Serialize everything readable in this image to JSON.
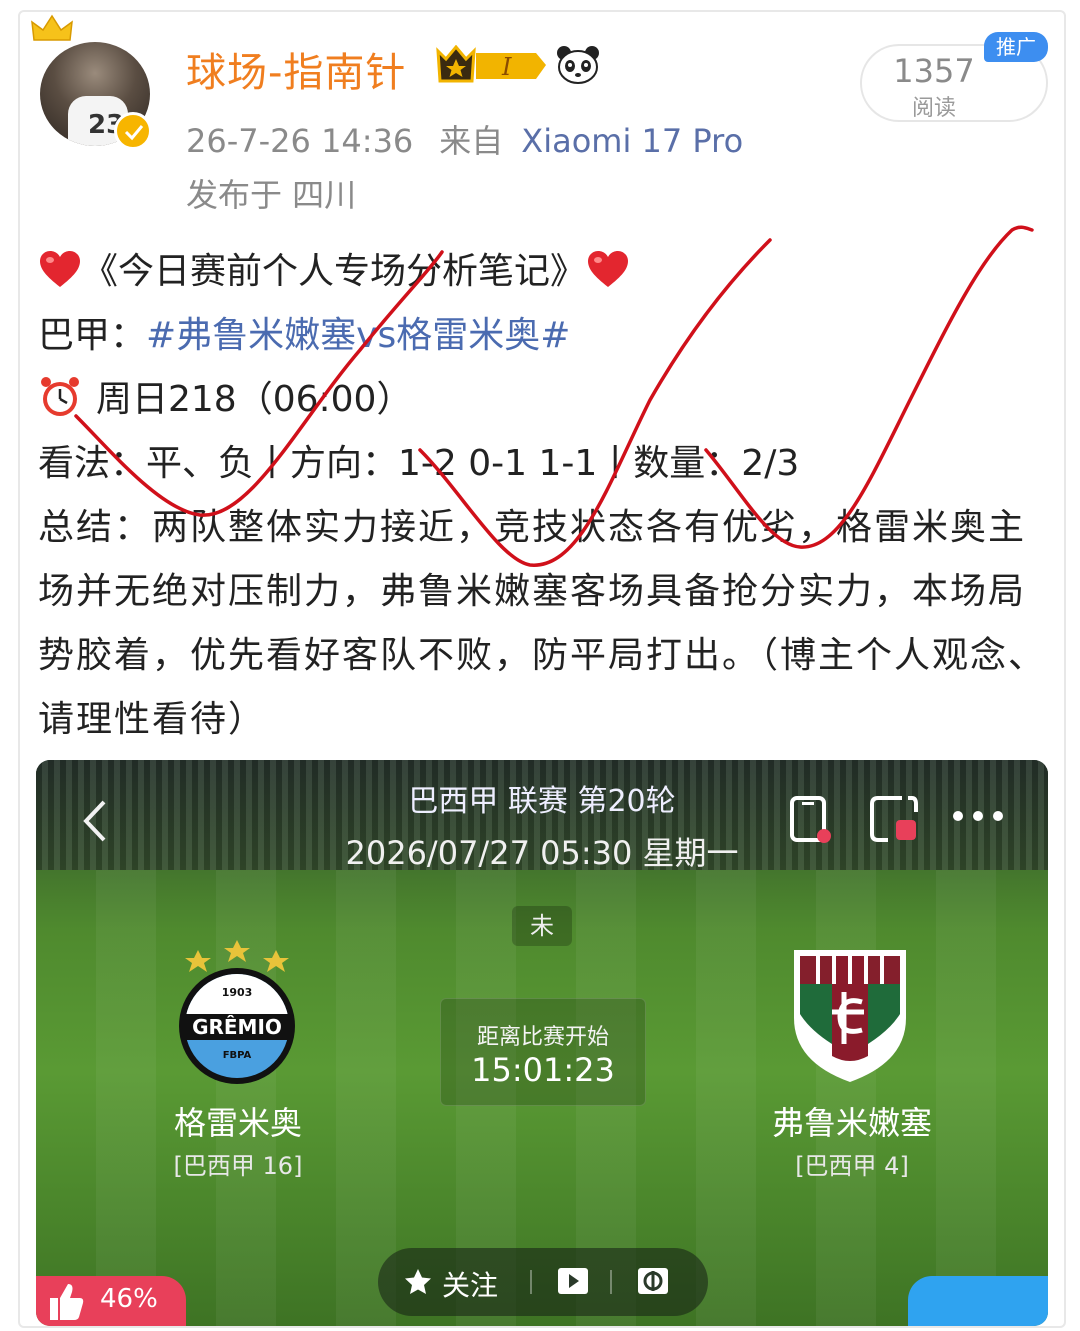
{
  "post": {
    "username": "球场-指南针",
    "vip_level": "I",
    "timestamp": "26-7-26 14:36",
    "from_label": "来自",
    "device": "Xiaomi 17 Pro",
    "location": "发布于 四川",
    "read_count": "1357",
    "read_label": "阅读",
    "promo_badge": "推广",
    "avatar_number": "23"
  },
  "content": {
    "title": "《今日赛前个人专场分析笔记》",
    "league_prefix": "巴甲：",
    "topic": "#弗鲁米嫩塞vs格雷米奥#",
    "schedule": "周日218（06:00）",
    "opinion": "看法：平、负丨方向：1-2 0-1 1-1丨数量：2/3",
    "summary": "总结：两队整体实力接近，竞技状态各有优劣，格雷米奥主场并无绝对压制力，弗鲁米嫩塞客场具备抢分实力，本场局势胶着，优先看好客队不败，防平局打出。（博主个人观念、请理性看待）"
  },
  "match_card": {
    "league_title": "巴西甲 联赛 第20轮",
    "datetime": "2026/07/27 05:30 星期一",
    "status": "未",
    "countdown_label": "距离比赛开始",
    "countdown": "15:01:23",
    "home_team": "格雷米奥",
    "home_rank": "[巴西甲 16]",
    "away_team": "弗鲁米嫩塞",
    "away_rank": "[巴西甲 4]",
    "home_logo_year": "1903",
    "home_logo_text": "GRÊMIO",
    "home_logo_sub": "FBPA",
    "follow_label": "关注",
    "like_percent": "46%"
  },
  "colors": {
    "username": "#f07e1f",
    "topic": "#4b6bb0",
    "pitch": "#5a9a34",
    "like_badge": "#e8405a",
    "promo": "#3d8ef0",
    "annotation_ink": "#d0101a"
  }
}
